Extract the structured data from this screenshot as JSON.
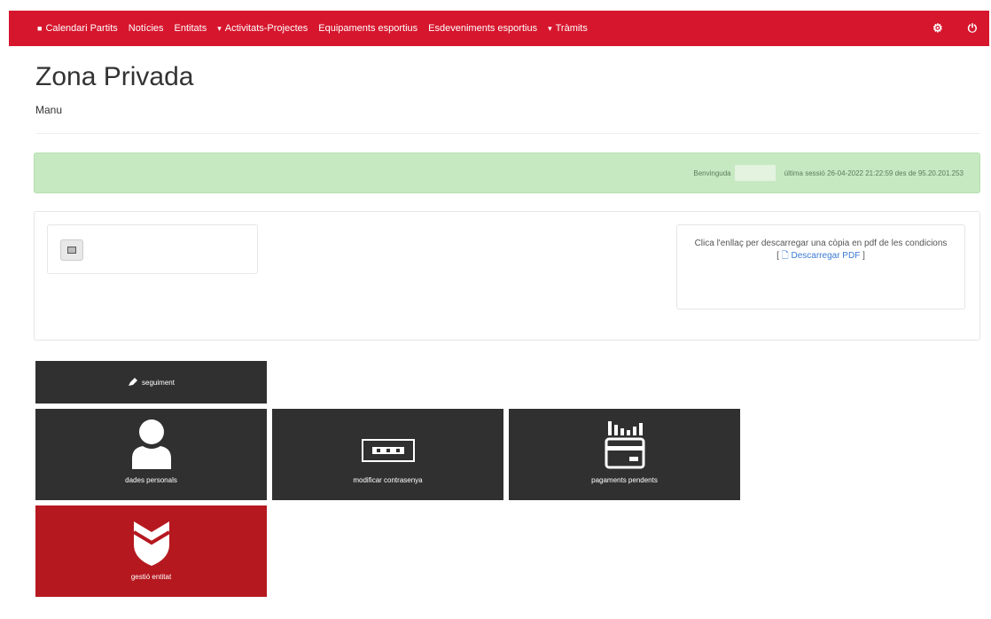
{
  "nav": {
    "items": [
      {
        "lead": "■",
        "label": "Calendari Partits"
      },
      {
        "lead": "",
        "label": "Notícies"
      },
      {
        "lead": "",
        "label": "Entitats"
      },
      {
        "lead": "▾",
        "label": "Activitats-Projectes"
      },
      {
        "lead": "",
        "label": "Equipaments esportius"
      },
      {
        "lead": "",
        "label": "Esdeveniments esportius"
      },
      {
        "lead": "▾",
        "label": "Tràmits"
      }
    ],
    "gear_icon": "⚙",
    "power_icon": "⏻"
  },
  "page": {
    "title": "Zona Privada",
    "subtitle": "Manu"
  },
  "alert": {
    "welcome": "Benvinguda",
    "last_access": "última sessió 26-04-2022 21:22:59 des de 95.20.201.253"
  },
  "panel": {
    "pdf_text": "Clica l'enllaç per descarregar una còpia en pdf de les condicions",
    "pdf_link": "Descarregar PDF",
    "bracket_open": "[",
    "bracket_close": "]"
  },
  "tiles": {
    "seguiment": "seguiment",
    "dades": "dades personals",
    "contrasenya": "modificar contrasenya",
    "pagaments": "pagaments pendents",
    "gestio": "gestió entitat"
  },
  "colors": {
    "nav_red": "#d6162d",
    "tile_dark": "#303030",
    "tile_red": "#b5181f",
    "alert_green": "#c6e9c2"
  }
}
